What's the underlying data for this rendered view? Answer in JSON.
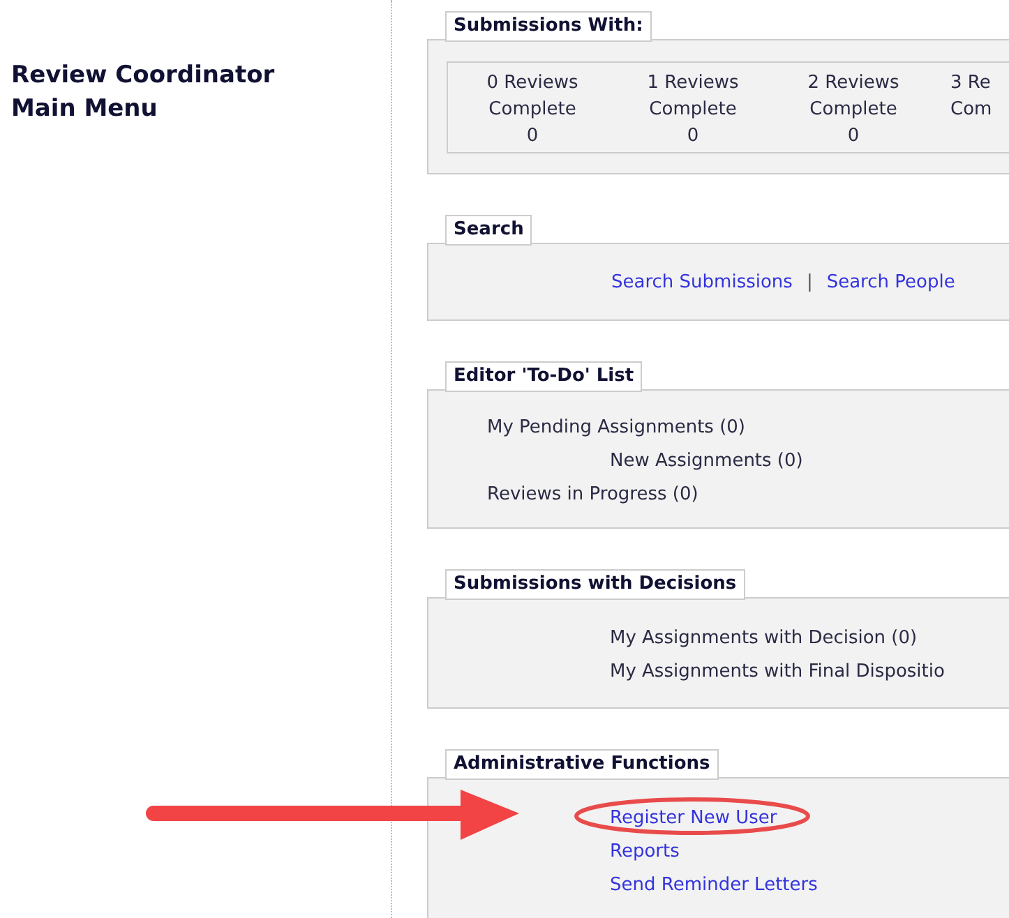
{
  "page_title": "Review Coordinator Main Menu",
  "sections": [
    {
      "kind": "counts",
      "title": "Submissions With:",
      "columns": [
        {
          "label": "0 Reviews Complete",
          "count": "0"
        },
        {
          "label": "1 Reviews Complete",
          "count": "0"
        },
        {
          "label": "2 Reviews Complete",
          "count": "0"
        },
        {
          "label": "3 Re Com"
        }
      ]
    },
    {
      "kind": "inline",
      "title": "Search",
      "links": [
        "Search Submissions",
        "Search People"
      ],
      "separator": "|"
    },
    {
      "kind": "list",
      "title": "Editor 'To-Do' List",
      "items": [
        {
          "label": "My Pending Assignments (0)",
          "link": false,
          "children": [
            {
              "label": "New Assignments (0)",
              "link": false
            }
          ]
        },
        {
          "label": "Reviews in Progress (0)",
          "link": false
        }
      ]
    },
    {
      "kind": "indented",
      "title": "Submissions with Decisions",
      "items": [
        {
          "label": "My Assignments with Decision (0)",
          "link": false
        },
        {
          "label": "My Assignments with Final Dispositio",
          "link": false
        }
      ]
    },
    {
      "kind": "indented",
      "title": "Administrative Functions",
      "items": [
        {
          "label": "Register New User",
          "link": true
        },
        {
          "label": "Reports",
          "link": true
        },
        {
          "label": "Send Reminder Letters",
          "link": true
        }
      ]
    }
  ]
}
